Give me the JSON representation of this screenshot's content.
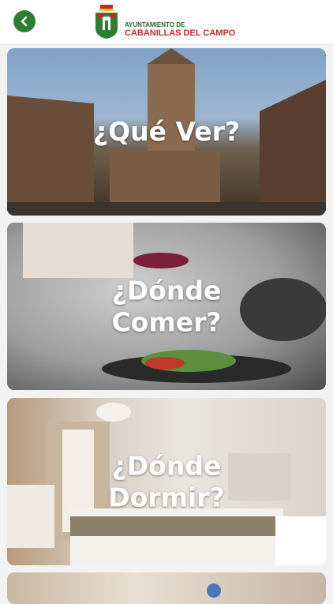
{
  "header": {
    "logo_line1": "AYUNTAMIENTO DE",
    "logo_line2": "CABANILLAS DEL CAMPO",
    "back_icon": "chevron-left-icon",
    "accent_color": "#2e7d32"
  },
  "cards": [
    {
      "line1": "¿Qué Ver?",
      "line2": ""
    },
    {
      "line1": "¿Dónde",
      "line2": "Comer?"
    },
    {
      "line1": "¿Dónde",
      "line2": "Dormir?"
    }
  ]
}
